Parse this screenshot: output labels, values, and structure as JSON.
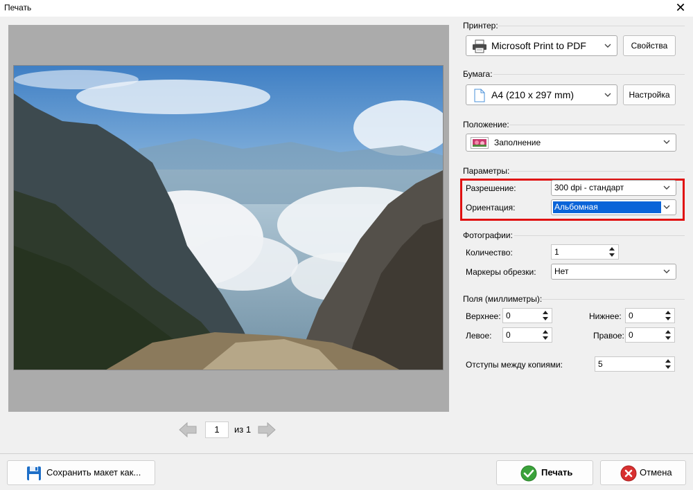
{
  "window": {
    "title": "Печать",
    "close_glyph": "✕"
  },
  "pager": {
    "current_page": "1",
    "of_label": "из 1"
  },
  "printer": {
    "label": "Принтер:",
    "selected": "Microsoft Print to PDF",
    "properties_button": "Свойства",
    "icon": "printer-icon"
  },
  "paper": {
    "label": "Бумага:",
    "selected": "A4 (210 x 297 mm)",
    "setup_button": "Настройка",
    "icon": "paper-icon"
  },
  "position": {
    "label": "Положение:",
    "selected": "Заполнение",
    "icon": "fill-layout-icon"
  },
  "parameters": {
    "label": "Параметры:",
    "resolution_label": "Разрешение:",
    "resolution_value": "300 dpi - стандарт",
    "orientation_label": "Ориентация:",
    "orientation_value": "Альбомная"
  },
  "photos": {
    "label": "Фотографии:",
    "quantity_label": "Количество:",
    "quantity_value": "1",
    "crop_marks_label": "Маркеры обрезки:",
    "crop_marks_value": "Нет"
  },
  "margins": {
    "label": "Поля (миллиметры):",
    "top_label": "Верхнее:",
    "top_value": "0",
    "bottom_label": "Нижнее:",
    "bottom_value": "0",
    "left_label": "Левое:",
    "left_value": "0",
    "right_label": "Правое:",
    "right_value": "0",
    "spacing_label": "Отступы между копиями:",
    "spacing_value": "5"
  },
  "footer": {
    "save_layout_button": "Сохранить макет как...",
    "print_button": "Печать",
    "cancel_button": "Отмена"
  },
  "colors": {
    "accent_selection": "#0a64d8",
    "highlight_border": "#e01010",
    "print_icon_green": "#3aa23a",
    "cancel_icon_red": "#d83030",
    "save_icon_blue": "#1e6fc8"
  }
}
